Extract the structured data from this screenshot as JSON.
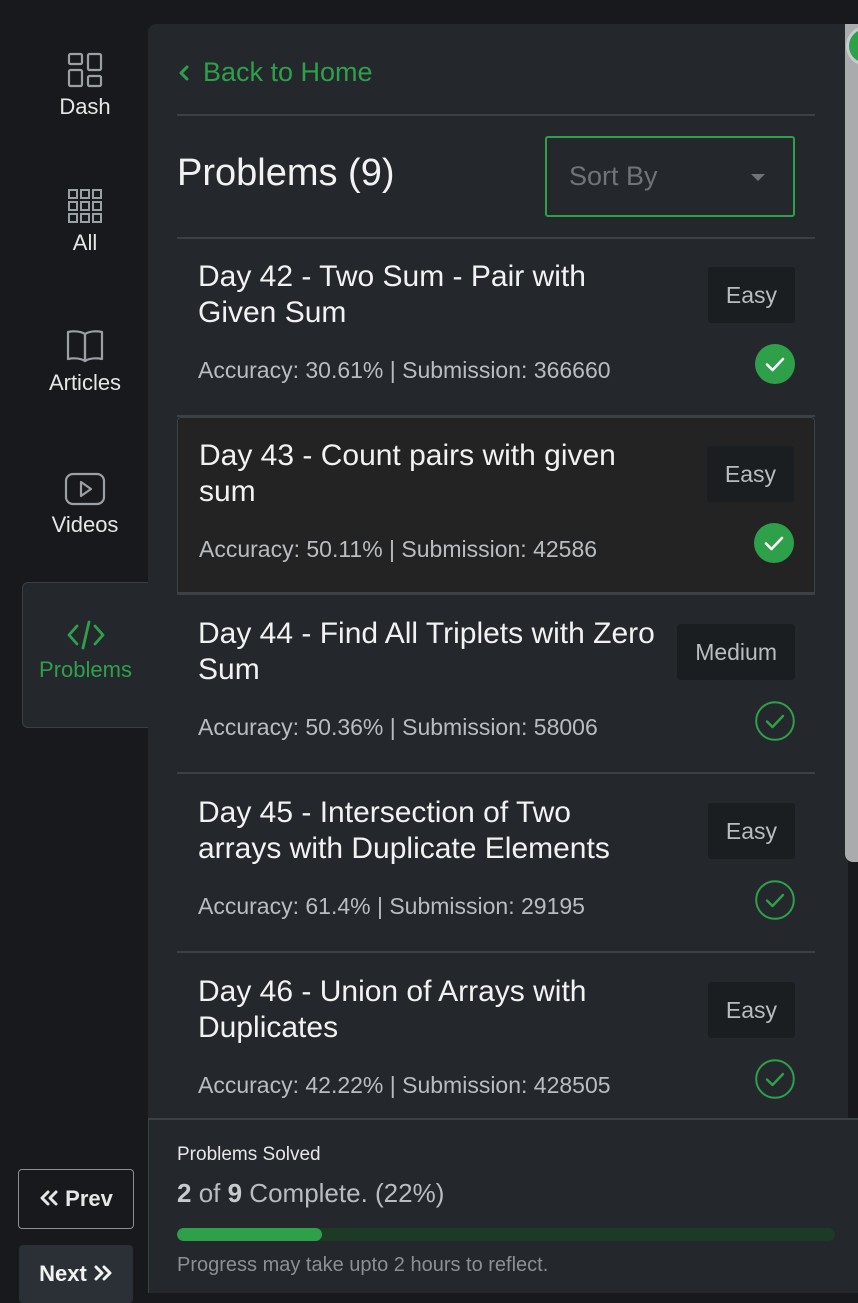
{
  "sidebar": {
    "items": [
      {
        "label": "Dash",
        "icon": "dashboard-icon"
      },
      {
        "label": "All",
        "icon": "grid-icon"
      },
      {
        "label": "Articles",
        "icon": "book-icon"
      },
      {
        "label": "Videos",
        "icon": "play-icon"
      },
      {
        "label": "Problems",
        "icon": "code-icon",
        "active": true
      }
    ],
    "prev_label": "Prev",
    "next_label": "Next"
  },
  "header": {
    "back_label": "Back to Home",
    "title": "Problems (9)",
    "sort_placeholder": "Sort By"
  },
  "problems": [
    {
      "title": "Day 42 - Two Sum - Pair with Given Sum",
      "difficulty": "Easy",
      "meta": "Accuracy: 30.61% | Submission: 366660",
      "solved_style": "filled"
    },
    {
      "title": "Day 43 - Count pairs with given sum",
      "difficulty": "Easy",
      "meta": "Accuracy: 50.11% | Submission: 42586",
      "solved_style": "filled"
    },
    {
      "title": "Day 44 - Find All Triplets with Zero Sum",
      "difficulty": "Medium",
      "meta": "Accuracy: 50.36% | Submission: 58006",
      "solved_style": "outline"
    },
    {
      "title": "Day 45 - Intersection of Two arrays with Duplicate Elements",
      "difficulty": "Easy",
      "meta": "Accuracy: 61.4% | Submission: 29195",
      "solved_style": "outline"
    },
    {
      "title": "Day 46 - Union of Arrays with Duplicates",
      "difficulty": "Easy",
      "meta": "Accuracy: 42.22% | Submission: 428505",
      "solved_style": "outline"
    }
  ],
  "footer": {
    "label": "Problems Solved",
    "solved": "2",
    "of_text": " of ",
    "total": "9",
    "suffix": " Complete. (22%)",
    "progress": 0.22,
    "note": "Progress may take upto 2 hours to reflect."
  },
  "colors": {
    "accent": "#2fa04a",
    "panel": "#24282c",
    "background": "#17191c"
  }
}
